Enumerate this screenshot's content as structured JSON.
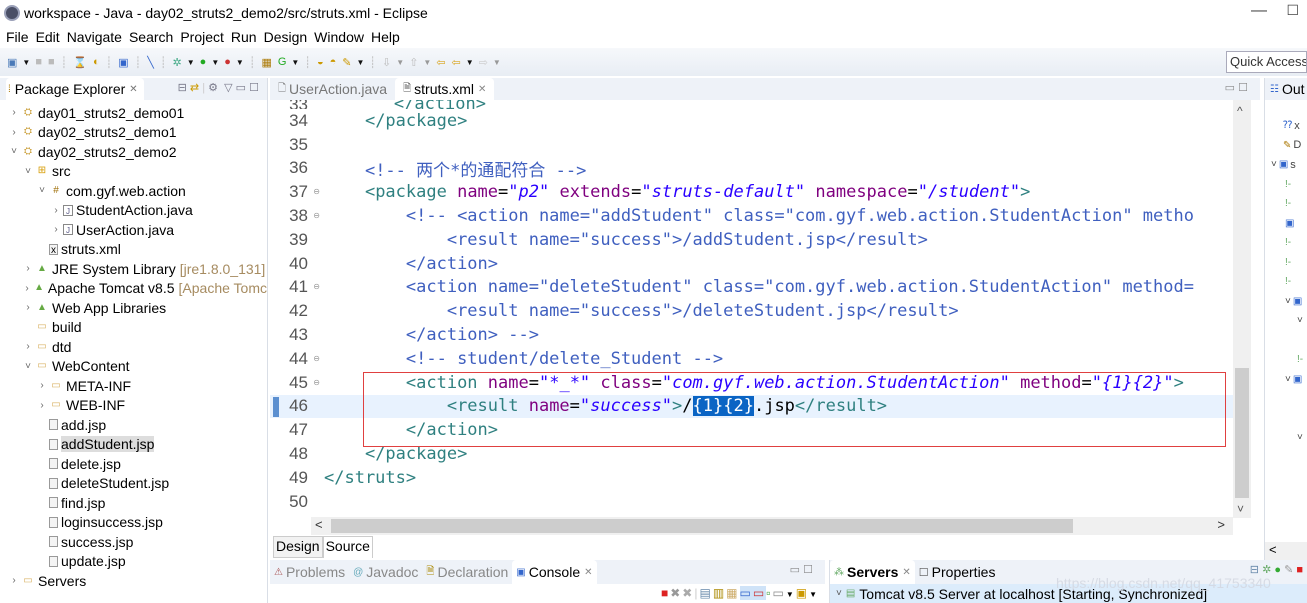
{
  "window": {
    "title": "workspace - Java - day02_struts2_demo2/src/struts.xml - Eclipse",
    "minimize": "—",
    "maximize": "☐"
  },
  "menu": [
    "File",
    "Edit",
    "Navigate",
    "Search",
    "Project",
    "Run",
    "Design",
    "Window",
    "Help"
  ],
  "toolbar": {
    "quick_access_placeholder": "Quick Access"
  },
  "package_explorer": {
    "title": "Package Explorer",
    "tree": [
      {
        "label": "day01_struts2_demo01",
        "icon": "project-icon",
        "expanded": false,
        "level": 0
      },
      {
        "label": "day02_struts2_demo1",
        "icon": "project-icon",
        "expanded": false,
        "level": 0
      },
      {
        "label": "day02_struts2_demo2",
        "icon": "project-icon",
        "expanded": true,
        "level": 0
      },
      {
        "label": "src",
        "icon": "source-folder-icon",
        "expanded": true,
        "level": 1
      },
      {
        "label": "com.gyf.web.action",
        "icon": "package-icon",
        "expanded": true,
        "level": 2
      },
      {
        "label": "StudentAction.java",
        "icon": "java-file-icon",
        "expanded": false,
        "level": 3
      },
      {
        "label": "UserAction.java",
        "icon": "java-file-icon",
        "expanded": false,
        "level": 3
      },
      {
        "label": "struts.xml",
        "icon": "xml-file-icon",
        "level": 2
      },
      {
        "label": "JRE System Library",
        "decoration": "[jre1.8.0_131]",
        "icon": "library-icon",
        "expanded": false,
        "level": 1
      },
      {
        "label": "Apache Tomcat v8.5",
        "decoration": "[Apache Tomc",
        "icon": "library-icon",
        "expanded": false,
        "level": 1
      },
      {
        "label": "Web App Libraries",
        "icon": "library-icon",
        "expanded": false,
        "level": 1
      },
      {
        "label": "build",
        "icon": "folder-icon",
        "level": 1
      },
      {
        "label": "dtd",
        "icon": "folder-icon",
        "expanded": false,
        "level": 1
      },
      {
        "label": "WebContent",
        "icon": "folder-icon",
        "expanded": true,
        "level": 1
      },
      {
        "label": "META-INF",
        "icon": "folder-icon",
        "expanded": false,
        "level": 2
      },
      {
        "label": "WEB-INF",
        "icon": "folder-icon",
        "expanded": false,
        "level": 2
      },
      {
        "label": "add.jsp",
        "icon": "jsp-file-icon",
        "level": 2
      },
      {
        "label": "addStudent.jsp",
        "icon": "jsp-file-icon",
        "level": 2,
        "selected": true
      },
      {
        "label": "delete.jsp",
        "icon": "jsp-file-icon",
        "level": 2
      },
      {
        "label": "deleteStudent.jsp",
        "icon": "jsp-file-icon",
        "level": 2
      },
      {
        "label": "find.jsp",
        "icon": "jsp-file-icon",
        "level": 2
      },
      {
        "label": "loginsuccess.jsp",
        "icon": "jsp-file-icon",
        "level": 2
      },
      {
        "label": "success.jsp",
        "icon": "jsp-file-icon",
        "level": 2
      },
      {
        "label": "update.jsp",
        "icon": "jsp-file-icon",
        "level": 2
      },
      {
        "label": "Servers",
        "icon": "folder-icon",
        "expanded": false,
        "level": 0
      }
    ]
  },
  "editor": {
    "tabs": [
      {
        "label": "UserAction.java",
        "active": false
      },
      {
        "label": "struts.xml",
        "active": true
      }
    ],
    "bottom_tabs": [
      "Design",
      "Source"
    ],
    "active_bottom_tab": "Source",
    "current_line": 46,
    "lines": [
      {
        "n": "34",
        "fold": false,
        "tokens": [
          [
            "    ",
            "txt"
          ],
          [
            "</package>",
            "t"
          ]
        ]
      },
      {
        "n": "35",
        "fold": false,
        "tokens": []
      },
      {
        "n": "36",
        "fold": false,
        "tokens": [
          [
            "    ",
            "txt"
          ],
          [
            "<!-- 两个*的通配符合 -->",
            "c"
          ]
        ]
      },
      {
        "n": "37",
        "fold": true,
        "tokens": [
          [
            "    ",
            "txt"
          ],
          [
            "<package ",
            "t"
          ],
          [
            "name",
            "a"
          ],
          [
            "=",
            "txt"
          ],
          [
            "\"p2\"",
            "v"
          ],
          [
            " extends",
            "a"
          ],
          [
            "=",
            "txt"
          ],
          [
            "\"struts-default\"",
            "v"
          ],
          [
            " namespace",
            "a"
          ],
          [
            "=",
            "txt"
          ],
          [
            "\"/student\"",
            "v"
          ],
          [
            ">",
            "t"
          ]
        ]
      },
      {
        "n": "38",
        "fold": true,
        "tokens": [
          [
            "        ",
            "txt"
          ],
          [
            "<!-- <action name=\"addStudent\" class=\"com.gyf.web.action.StudentAction\" metho",
            "c"
          ]
        ]
      },
      {
        "n": "39",
        "fold": false,
        "tokens": [
          [
            "            ",
            "txt"
          ],
          [
            "<result name=\"success\">/addStudent.jsp</result>",
            "c"
          ]
        ]
      },
      {
        "n": "40",
        "fold": false,
        "tokens": [
          [
            "        ",
            "txt"
          ],
          [
            "</action>",
            "c"
          ]
        ]
      },
      {
        "n": "41",
        "fold": true,
        "tokens": [
          [
            "        ",
            "txt"
          ],
          [
            "<action name=\"deleteStudent\" class=\"com.gyf.web.action.StudentAction\" method=",
            "c"
          ]
        ]
      },
      {
        "n": "42",
        "fold": false,
        "tokens": [
          [
            "            ",
            "txt"
          ],
          [
            "<result name=\"success\">/deleteStudent.jsp</result>",
            "c"
          ]
        ]
      },
      {
        "n": "43",
        "fold": false,
        "tokens": [
          [
            "        ",
            "txt"
          ],
          [
            "</action> -->",
            "c"
          ]
        ]
      },
      {
        "n": "44",
        "fold": true,
        "tokens": [
          [
            "        ",
            "txt"
          ],
          [
            "<!-- student/delete_Student -->",
            "c"
          ]
        ]
      },
      {
        "n": "45",
        "fold": true,
        "tokens": [
          [
            "        ",
            "txt"
          ],
          [
            "<action ",
            "t"
          ],
          [
            "name",
            "a"
          ],
          [
            "=",
            "txt"
          ],
          [
            "\"*_*\"",
            "v"
          ],
          [
            " class",
            "a"
          ],
          [
            "=",
            "txt"
          ],
          [
            "\"com.gyf.web.action.StudentAction\"",
            "v"
          ],
          [
            " method",
            "a"
          ],
          [
            "=",
            "txt"
          ],
          [
            "\"{1}{2}\"",
            "v"
          ],
          [
            ">",
            "t"
          ]
        ]
      },
      {
        "n": "46",
        "fold": false,
        "tokens": [
          [
            "            ",
            "txt"
          ],
          [
            "<result ",
            "t"
          ],
          [
            "name",
            "a"
          ],
          [
            "=",
            "txt"
          ],
          [
            "\"success\"",
            "v"
          ],
          [
            ">",
            "t"
          ],
          [
            "/",
            "txt"
          ],
          [
            "{1}{2}",
            "hl"
          ],
          [
            ".jsp",
            "txt"
          ],
          [
            "</result>",
            "t"
          ]
        ]
      },
      {
        "n": "47",
        "fold": false,
        "tokens": [
          [
            "        ",
            "txt"
          ],
          [
            "</action>",
            "t"
          ]
        ]
      },
      {
        "n": "48",
        "fold": false,
        "tokens": [
          [
            "    ",
            "txt"
          ],
          [
            "</package>",
            "t"
          ]
        ]
      },
      {
        "n": "49",
        "fold": false,
        "tokens": [
          [
            "</struts>",
            "t"
          ]
        ]
      },
      {
        "n": "50",
        "fold": false,
        "tokens": []
      }
    ]
  },
  "outline": {
    "title": "Out",
    "rows": [
      {
        "icon": "?-?",
        "label": "x",
        "cls": "ol-b"
      },
      {
        "icon": "✎",
        "label": "D",
        "cls": "ol-b"
      },
      {
        "icon": "˅ ▣",
        "label": "s",
        "cls": "ol-b"
      }
    ]
  },
  "bottom_panel": {
    "tabs": [
      {
        "label": "Problems",
        "active": false
      },
      {
        "label": "Javadoc",
        "active": false
      },
      {
        "label": "Declaration",
        "active": false
      },
      {
        "label": "Console",
        "active": true
      }
    ]
  },
  "servers_panel": {
    "tabs": [
      {
        "label": "Servers",
        "active": true
      },
      {
        "label": "Properties",
        "active": false
      }
    ],
    "server_entry": "Tomcat v8.5 Server at localhost  [Starting, Synchronized]"
  },
  "watermark": "https://blog.csdn.net/qq_41753340",
  "colors": {
    "tag": "#2f8080",
    "attribute": "#7f007f",
    "value": "#2a00ff",
    "comment": "#3f5fbf",
    "highlight": "#0a64c4",
    "annotation_box": "#e04040"
  }
}
